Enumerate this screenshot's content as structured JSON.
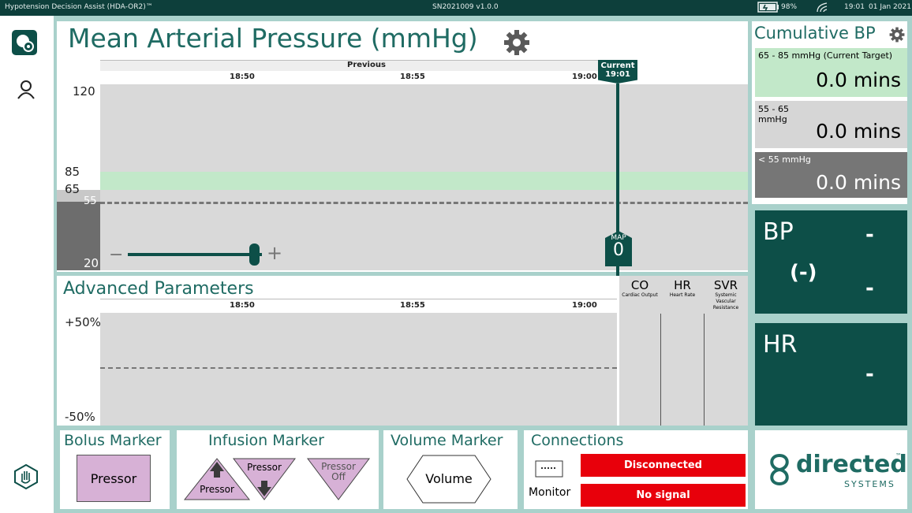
{
  "topbar": {
    "app_title": "Hypotension Decision Assist (HDA-OR2)™",
    "serial": "SN2021009 v1.0.0",
    "battery": "98%",
    "time": "19:01",
    "date": "01 Jan 2021"
  },
  "map_chart": {
    "title": "Mean Arterial Pressure (mmHg)",
    "previous_label": "Previous",
    "current_label": "Current",
    "current_time": "19:01",
    "ticks": [
      "18:50",
      "18:55",
      "19:00"
    ],
    "y_labels": [
      "120",
      "85",
      "65",
      "55",
      "20"
    ],
    "map_badge_label": "MAP",
    "map_value": "0",
    "slider_minus": "−",
    "slider_plus": "+",
    "slider_level": 0.98
  },
  "advanced": {
    "title": "Advanced Parameters",
    "ticks": [
      "18:50",
      "18:55",
      "19:00"
    ],
    "y_top": "+50%",
    "y_bottom": "-50%",
    "params": [
      {
        "abbr": "CO",
        "desc": "Cardiac Output"
      },
      {
        "abbr": "HR",
        "desc": "Heart Rate"
      },
      {
        "abbr": "SVR",
        "desc": "Systemic Vascular Resistance"
      }
    ]
  },
  "cumulative": {
    "title": "Cumulative BP",
    "rows": [
      {
        "label": "65 - 85 mmHg (Current Target)",
        "value": "0.0 mins",
        "color": "#c2e8c9"
      },
      {
        "label": "55 - 65 mmHg",
        "value": "0.0 mins",
        "color": "#d6d6d6"
      },
      {
        "label": "< 55 mmHg",
        "value": "0.0 mins",
        "color": "#767676"
      }
    ]
  },
  "bp_card": {
    "title": "BP",
    "value_top": "-",
    "paren": "(-)",
    "value_bottom": "-"
  },
  "hr_card": {
    "title": "HR",
    "value": "-"
  },
  "markers": {
    "bolus_title": "Bolus Marker",
    "bolus_button": "Pressor",
    "infusion_title": "Infusion Marker",
    "infusion_up": "Pressor",
    "infusion_down": "Pressor",
    "infusion_off_line1": "Pressor",
    "infusion_off_line2": "Off",
    "volume_title": "Volume Marker",
    "volume_button": "Volume"
  },
  "connections": {
    "title": "Connections",
    "monitor_label": "Monitor",
    "status1": "Disconnected",
    "status2": "No signal",
    "status_color": "#e8000b"
  },
  "logo": {
    "word": "directed",
    "tm": "™",
    "sub": "SYSTEMS"
  },
  "colors": {
    "accent": "#1f6b63",
    "dark_teal": "#0d4f48",
    "frame": "#a9d1cb",
    "target_band": "#c2e8c9"
  }
}
